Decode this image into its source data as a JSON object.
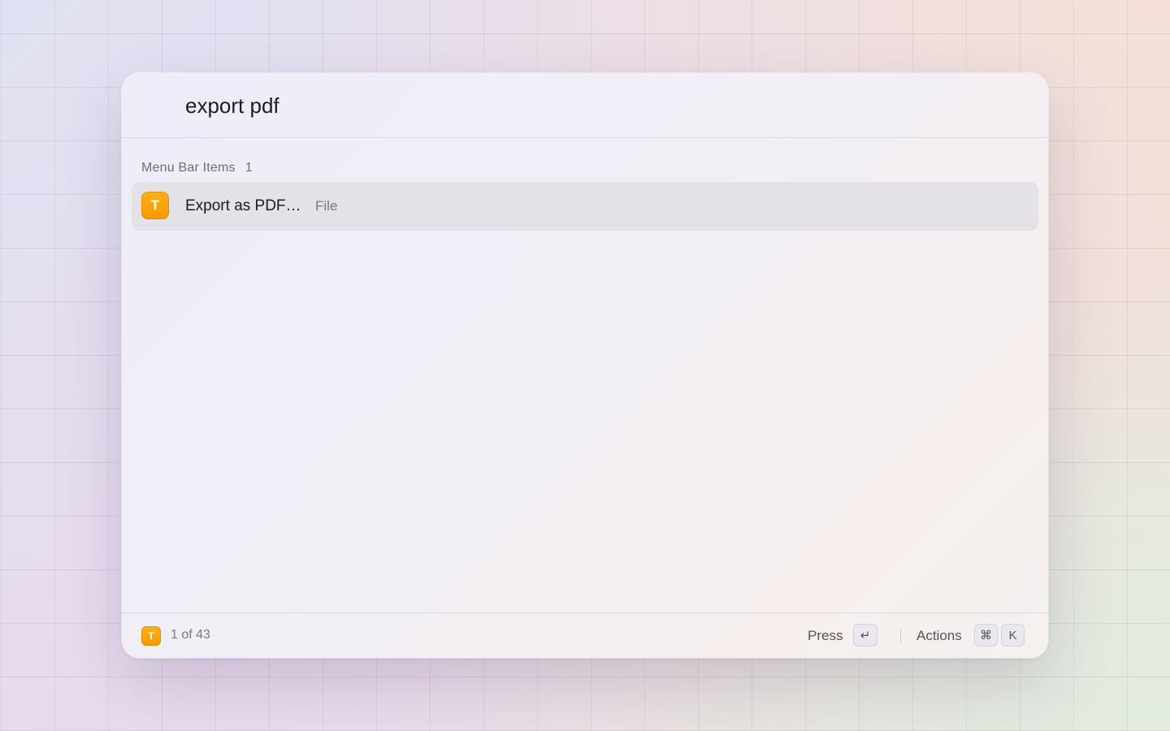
{
  "search": {
    "value": "export pdf"
  },
  "section": {
    "title": "Menu Bar Items",
    "count": "1"
  },
  "results": [
    {
      "icon_letter": "T",
      "title": "Export as PDF…",
      "subtitle": "File"
    }
  ],
  "footer": {
    "icon_letter": "T",
    "count_text": "1 of 43",
    "primary_action_label": "Press",
    "primary_key": "↵",
    "actions_label": "Actions",
    "actions_keys": [
      "⌘",
      "K"
    ]
  },
  "colors": {
    "app_icon": "#F59A00",
    "row_highlight": "#E4E1E7"
  }
}
